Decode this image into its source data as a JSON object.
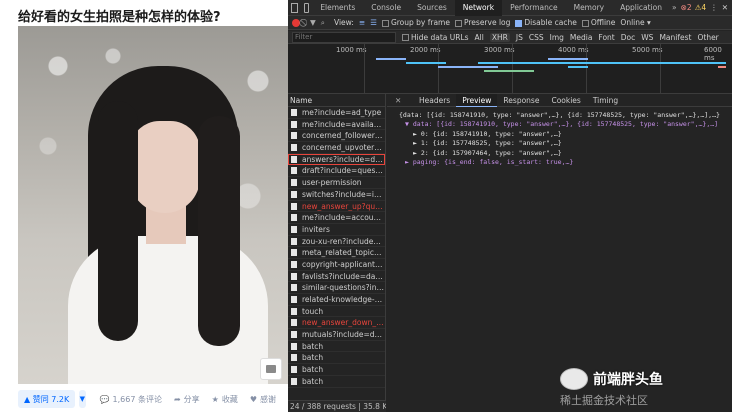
{
  "zhihu": {
    "question_title": "给好看的女生拍照是种怎样的体验?",
    "actions": {
      "upvote": "▲ 赞同 7.2K",
      "downvote": "▼",
      "comments": "1,667 条评论",
      "share": "分享",
      "favorite": "收藏",
      "thanks": "感谢"
    }
  },
  "devtools": {
    "tabs": [
      "Elements",
      "Console",
      "Sources",
      "Network",
      "Performance",
      "Memory",
      "Application"
    ],
    "active_tab": "Network",
    "errors": "2",
    "warnings": "4",
    "toolbar": {
      "view_label": "View:",
      "group_by_frame": "Group by frame",
      "preserve_log": "Preserve log",
      "disable_cache": "Disable cache",
      "offline": "Offline",
      "online": "Online"
    },
    "filter": {
      "placeholder": "Filter",
      "hide_data_urls": "Hide data URLs",
      "types": [
        "All",
        "XHR",
        "JS",
        "CSS",
        "Img",
        "Media",
        "Font",
        "Doc",
        "WS",
        "Manifest",
        "Other"
      ]
    },
    "timeline_labels": [
      "1000 ms",
      "2000 ms",
      "3000 ms",
      "4000 ms",
      "5000 ms",
      "6000 ms"
    ],
    "requests_header": "Name",
    "requests": [
      {
        "name": "me?include=ad_type",
        "red": false
      },
      {
        "name": "me?include=available_me...",
        "red": false
      },
      {
        "name": "concerned_followers?limit...",
        "red": false
      },
      {
        "name": "concerned_upvoters?limit...",
        "red": false
      },
      {
        "name": "answers?include=data%5...",
        "red": false,
        "selected": true
      },
      {
        "name": "draft?include=question",
        "red": false
      },
      {
        "name": "user-permission",
        "red": false
      },
      {
        "name": "switches?include=is_answ...",
        "red": false
      },
      {
        "name": "new_answer_up?question...",
        "red": true
      },
      {
        "name": "me?include=account_stat...",
        "red": false
      },
      {
        "name": "inviters",
        "red": false
      },
      {
        "name": "zou-xu-ren?include=locati...",
        "red": false
      },
      {
        "name": "meta_related_topics?inclu...",
        "red": false
      },
      {
        "name": "copyright-applicants?offs...",
        "red": false
      },
      {
        "name": "favlists?include=data%5B...",
        "red": false
      },
      {
        "name": "similar-questions?include...",
        "red": false
      },
      {
        "name": "related-knowledge-comm...",
        "red": false
      },
      {
        "name": "touch",
        "red": false
      },
      {
        "name": "new_answer_down_sticky...",
        "red": true
      },
      {
        "name": "mutuals?include=data%5...",
        "red": false
      },
      {
        "name": "batch",
        "red": false
      },
      {
        "name": "batch",
        "red": false
      },
      {
        "name": "batch",
        "red": false
      },
      {
        "name": "batch",
        "red": false
      }
    ],
    "status_footer": "24 / 388 requests | 35.8 KB / 1...",
    "detail_tabs": [
      "Headers",
      "Preview",
      "Response",
      "Cookies",
      "Timing"
    ],
    "active_detail_tab": "Preview",
    "preview_lines": [
      "{data: [{id: 158741910, type: \"answer\",…}, {id: 157748525, type: \"answer\",…},…],…}",
      "▼ data: [{id: 158741910, type: \"answer\",…}, {id: 157748525, type: \"answer\",…},…]",
      "► 0: {id: 158741910, type: \"answer\",…}",
      "► 1: {id: 157748525, type: \"answer\",…}",
      "► 2: {id: 157907464, type: \"answer\",…}",
      "► paging: {is_end: false, is_start: true,…}"
    ]
  },
  "watermark": {
    "name": "前端胖头鱼",
    "site": "稀土掘金技术社区"
  }
}
